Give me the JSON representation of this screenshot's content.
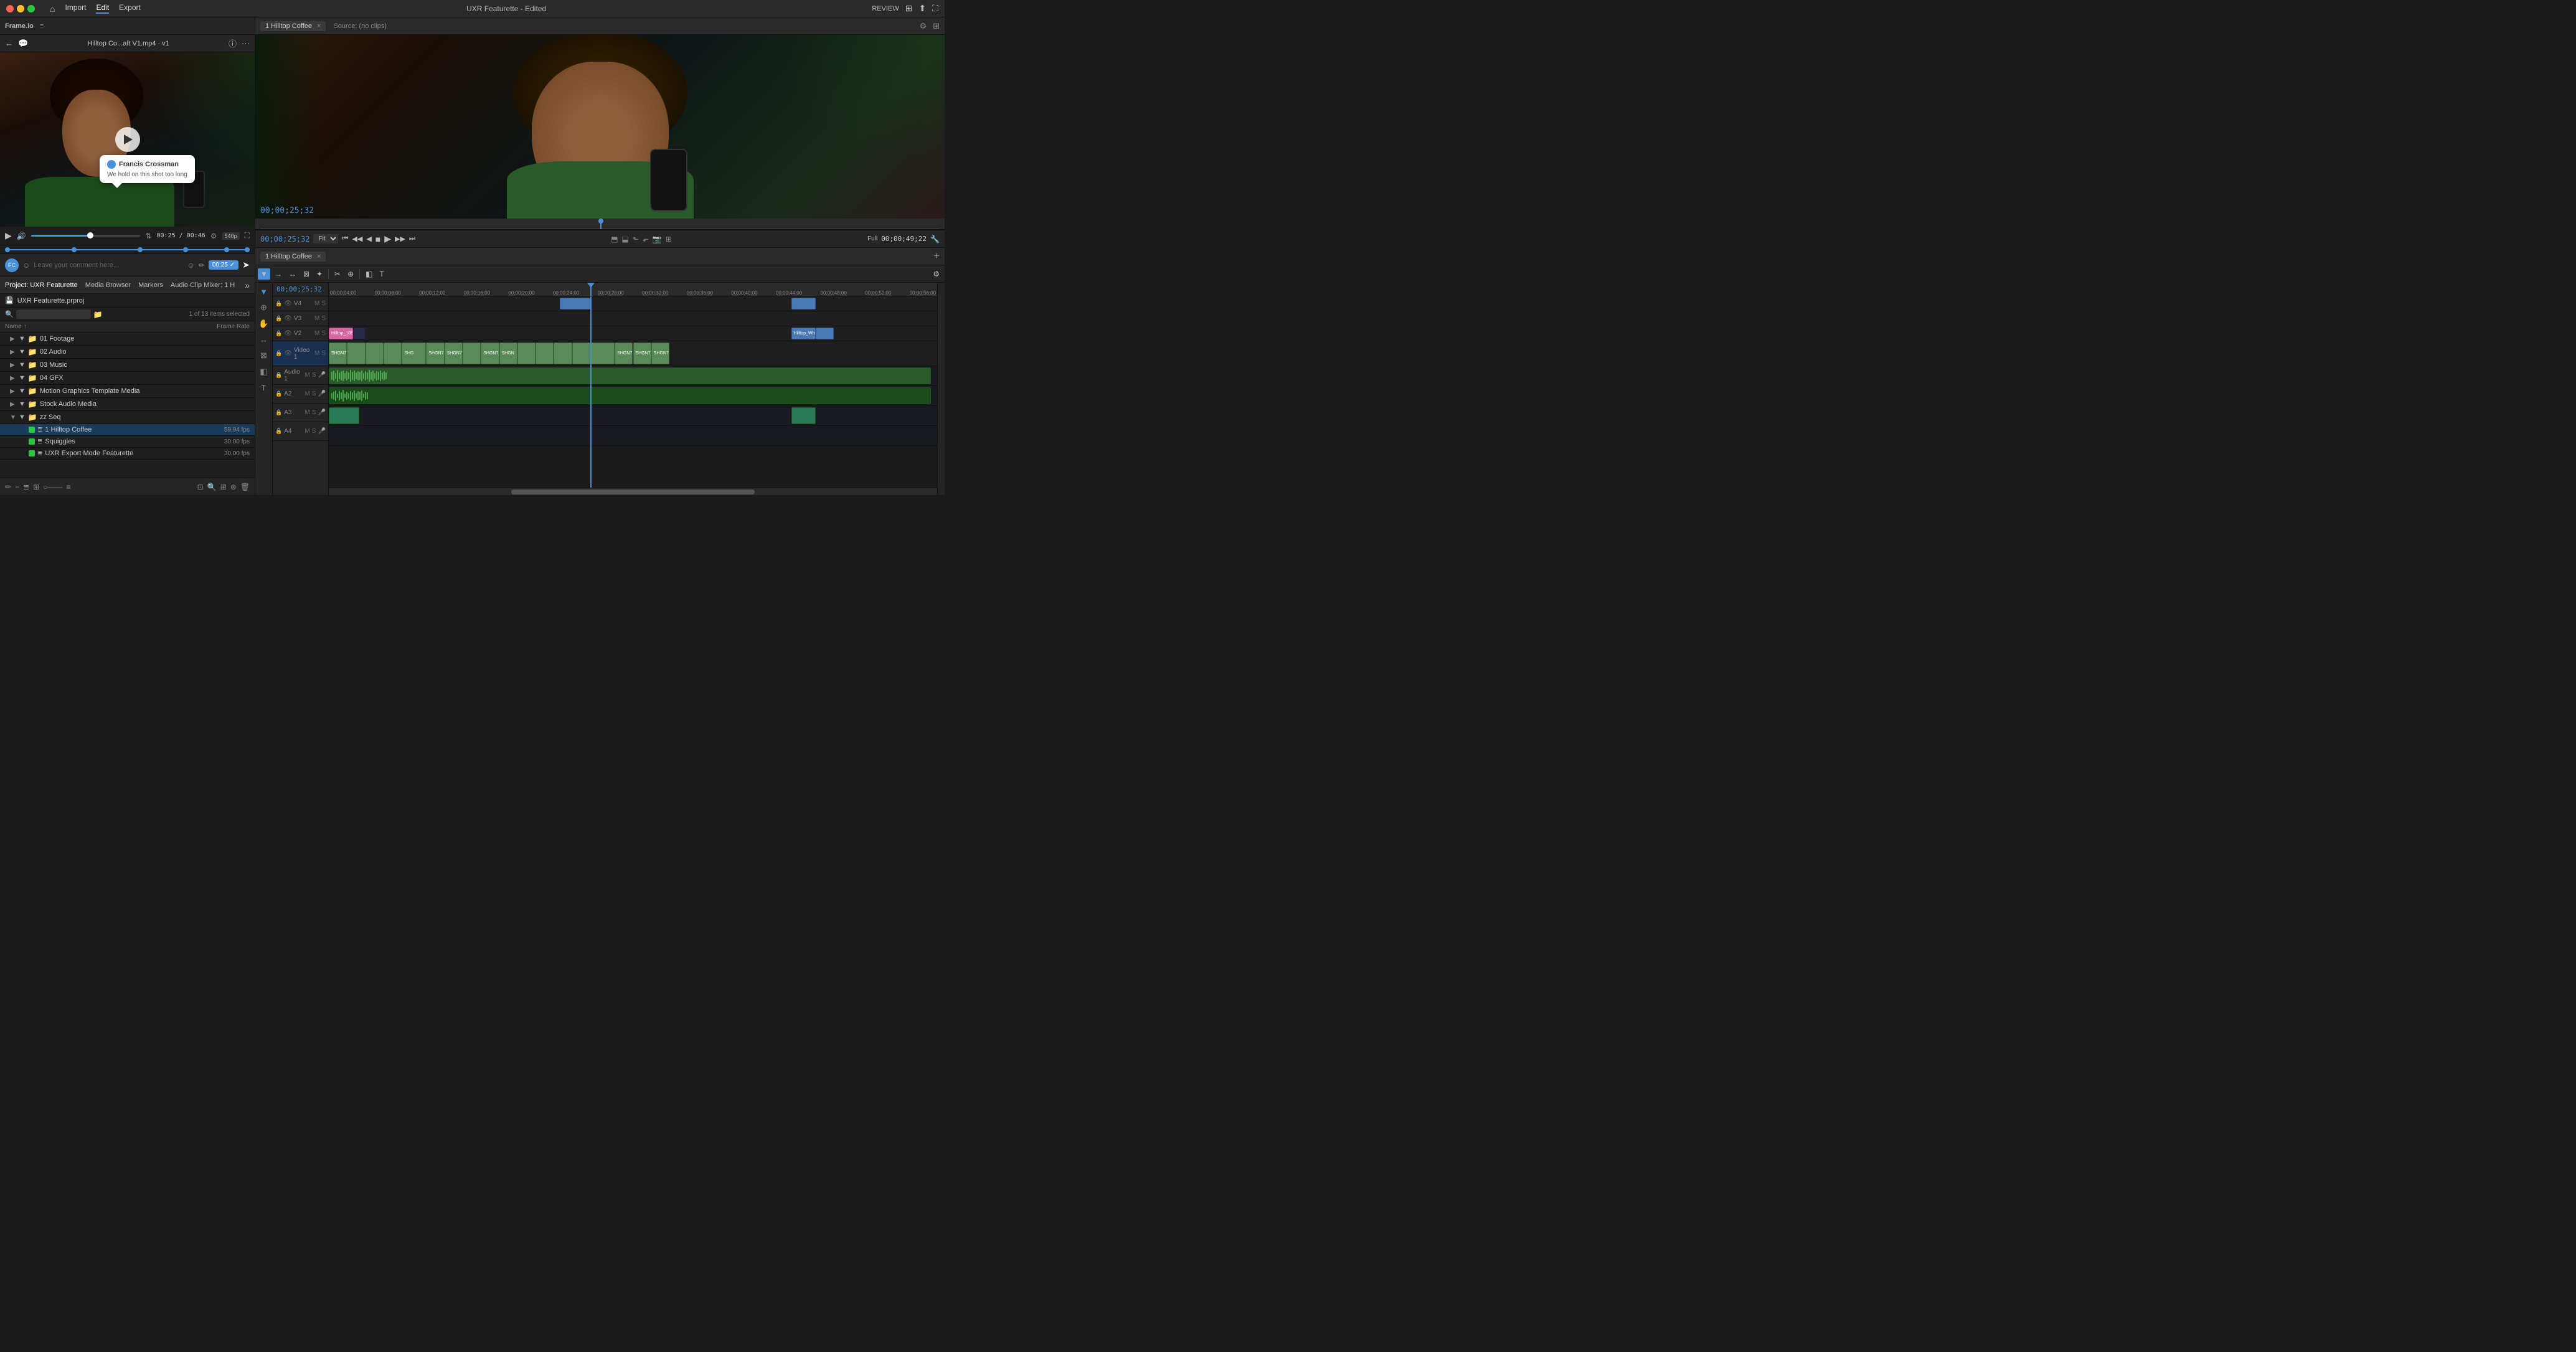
{
  "app": {
    "title": "UXR Featurette - Edited",
    "title_left": "UXR Featurette",
    "title_right": "Edited"
  },
  "top_bar": {
    "home_icon": "⌂",
    "import_label": "Import",
    "edit_label": "Edit",
    "export_label": "Export",
    "review_label": "REVIEW",
    "nav_active": "Edit"
  },
  "frameio": {
    "panel_title": "Frame.io",
    "hamburger": "≡"
  },
  "preview": {
    "back_icon": "←",
    "comment_icon": "💬",
    "title": "Hilltop Co...aft V1.mp4 · v1",
    "info_icon": "ⓘ",
    "more_icon": "···",
    "play_icon": "▶",
    "volume_icon": "🔊",
    "time_current": "00:25",
    "time_total": "00:46",
    "resolution": "540p",
    "fullscreen_icon": "⛶",
    "settings_icon": "⚙"
  },
  "annotation": {
    "user": "Francis Crossman",
    "text": "We hold on this shot too long",
    "avatar_color": "#4a90d9"
  },
  "comment_input": {
    "placeholder": "Leave your comment here...",
    "emoji_icon": "☺",
    "draw_icon": "✏",
    "timestamp": "00:25",
    "submit_icon": "➤"
  },
  "project_panel": {
    "tab_project": "Project: UXR Featurette",
    "tab_media": "Media Browser",
    "tab_markers": "Markers",
    "tab_audio": "Audio Clip Mixer: 1 H",
    "more": "»",
    "project_root": "UXR Featurette.prproj",
    "search_placeholder": "",
    "selection_info": "1 of 13 items selected",
    "col_name": "Name",
    "col_fr": "Frame Rate",
    "items": [
      {
        "id": "01",
        "name": "01 Footage",
        "type": "folder",
        "indent": 1,
        "color": null
      },
      {
        "id": "02",
        "name": "02 Audio",
        "type": "folder",
        "indent": 1,
        "color": null
      },
      {
        "id": "03",
        "name": "03 Music",
        "type": "folder",
        "indent": 1,
        "color": null
      },
      {
        "id": "04",
        "name": "04 GFX",
        "type": "folder",
        "indent": 1,
        "color": null
      },
      {
        "id": "05",
        "name": "Motion Graphics Template Media",
        "type": "folder",
        "indent": 1,
        "color": null
      },
      {
        "id": "06",
        "name": "Stock Audio Media",
        "type": "folder",
        "indent": 1,
        "color": null
      },
      {
        "id": "07",
        "name": "zz Seq",
        "type": "folder",
        "indent": 1,
        "color": null,
        "expanded": true
      },
      {
        "id": "07a",
        "name": "1 Hilltop Coffee",
        "type": "sequence",
        "indent": 2,
        "color": "#27c93f",
        "fr": "59.94 fps",
        "selected": true
      },
      {
        "id": "07b",
        "name": "Squiggles",
        "type": "sequence",
        "indent": 2,
        "color": "#27c93f",
        "fr": "30.00 fps"
      },
      {
        "id": "07c",
        "name": "UXR Export Mode Featurette",
        "type": "sequence",
        "indent": 2,
        "color": "#27c93f",
        "fr": "30.00 fps"
      }
    ]
  },
  "program_monitor": {
    "tab_label": "1 Hilltop Coffee",
    "tab_close": "×",
    "source_label": "Source: (no clips)",
    "timecode": "00;00;25;32",
    "fit_label": "Fit",
    "full_label": "Full",
    "timecode_right": "00;00;49;22",
    "controls": [
      "⏮",
      "◀◀",
      "◀",
      "▶",
      "▶▶",
      "⏭"
    ]
  },
  "timeline": {
    "tab_label": "1 Hilltop Coffee",
    "tab_close": "×",
    "timecode_display": "00;00;25;32",
    "add_track": "+",
    "ruler_marks": [
      "00;00;04;00",
      "00;00;08;00",
      "00;00;12;00",
      "00;00;16;00",
      "00;00;20;00",
      "00;00;24;00",
      "00;00;28;00",
      "00;00;32;00",
      "00;00;36;00",
      "00;00;40;00",
      "00;00;44;00",
      "00;00;48;00",
      "00;00;52;00",
      "00;00;56;00"
    ],
    "tracks": [
      {
        "id": "V4",
        "type": "video",
        "label": "V4"
      },
      {
        "id": "V3",
        "type": "video",
        "label": "V3"
      },
      {
        "id": "V2",
        "type": "video",
        "label": "V2"
      },
      {
        "id": "V1",
        "type": "video",
        "label": "Video 1",
        "tall": true
      },
      {
        "id": "A1",
        "type": "audio",
        "label": "Audio 1"
      },
      {
        "id": "A2",
        "type": "audio",
        "label": "A2"
      },
      {
        "id": "A3",
        "type": "audio",
        "label": "A3"
      },
      {
        "id": "A4",
        "type": "audio",
        "label": "A4"
      }
    ],
    "tools": [
      "▼",
      "≡",
      "←→",
      "↔",
      "⊠",
      "✦",
      "⊕",
      "◧",
      "T"
    ]
  }
}
